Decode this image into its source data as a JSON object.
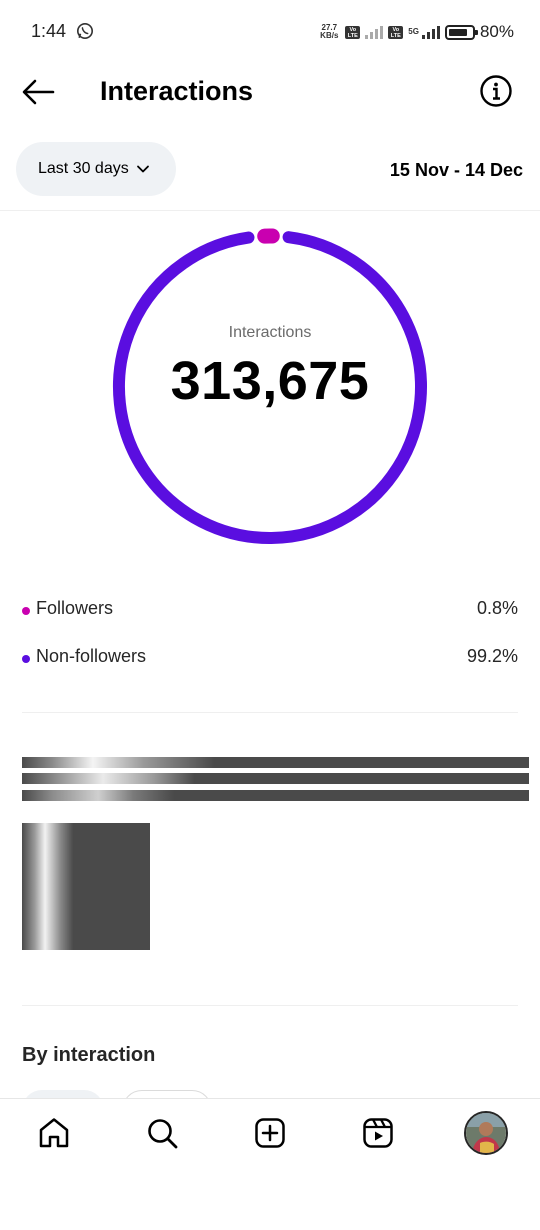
{
  "status_bar": {
    "time": "1:44",
    "net_speed_value": "27.7",
    "net_speed_unit": "KB/s",
    "volte_label_1": "Vo LTE",
    "volte_label_2": "Vo LTE",
    "network_type": "5G",
    "battery_pct": "80%",
    "battery_level": 0.8
  },
  "header": {
    "title": "Interactions"
  },
  "filters": {
    "range_label": "Last 30 days",
    "date_range": "15 Nov - 14 Dec"
  },
  "summary": {
    "label": "Interactions",
    "value": "313,675"
  },
  "breakdown": [
    {
      "label": "Followers",
      "value": "0.8%",
      "fraction": 0.008,
      "color": "#c900b0"
    },
    {
      "label": "Non-followers",
      "value": "99.2%",
      "fraction": 0.992,
      "color": "#5a0ee0"
    }
  ],
  "sections": {
    "by_interaction_title": "By interaction"
  },
  "nav": {
    "items": [
      "home-icon",
      "search-icon",
      "create-icon",
      "reels-icon",
      "profile-avatar"
    ]
  },
  "colors": {
    "accent_purple": "#5a0ee0",
    "accent_magenta": "#c900b0",
    "pill_bg": "#eff2f5"
  }
}
